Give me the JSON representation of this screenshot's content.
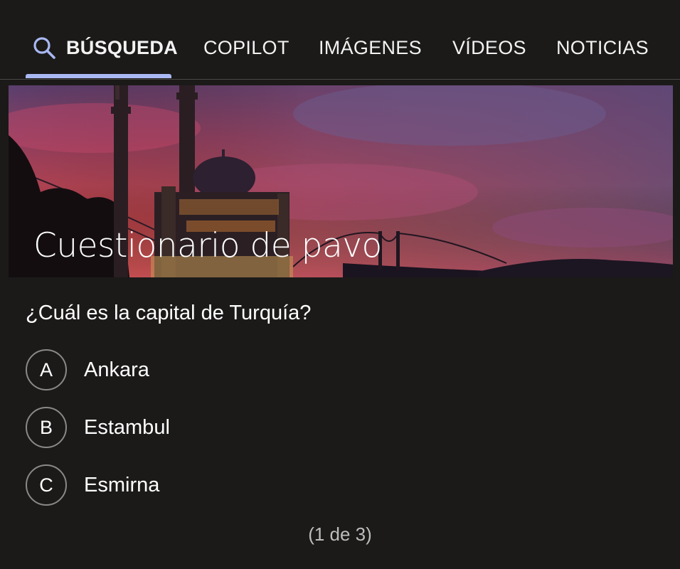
{
  "tabs": [
    {
      "label": "BÚSQUEDA",
      "active": true,
      "icon": "search-icon"
    },
    {
      "label": "COPILOT"
    },
    {
      "label": "IMÁGENES"
    },
    {
      "label": "VÍDEOS"
    },
    {
      "label": "NOTICIAS"
    }
  ],
  "colors": {
    "background": "#1b1a19",
    "active_tab_underline": "#a9b8f2",
    "option_circle_border": "#8a8988"
  },
  "quiz": {
    "title": "Cuestionario de pavo",
    "question": "¿Cuál es la capital de Turquía?",
    "options": [
      {
        "letter": "A",
        "text": "Ankara"
      },
      {
        "letter": "B",
        "text": "Estambul"
      },
      {
        "letter": "C",
        "text": "Esmirna"
      }
    ],
    "progress": "(1 de 3)"
  }
}
